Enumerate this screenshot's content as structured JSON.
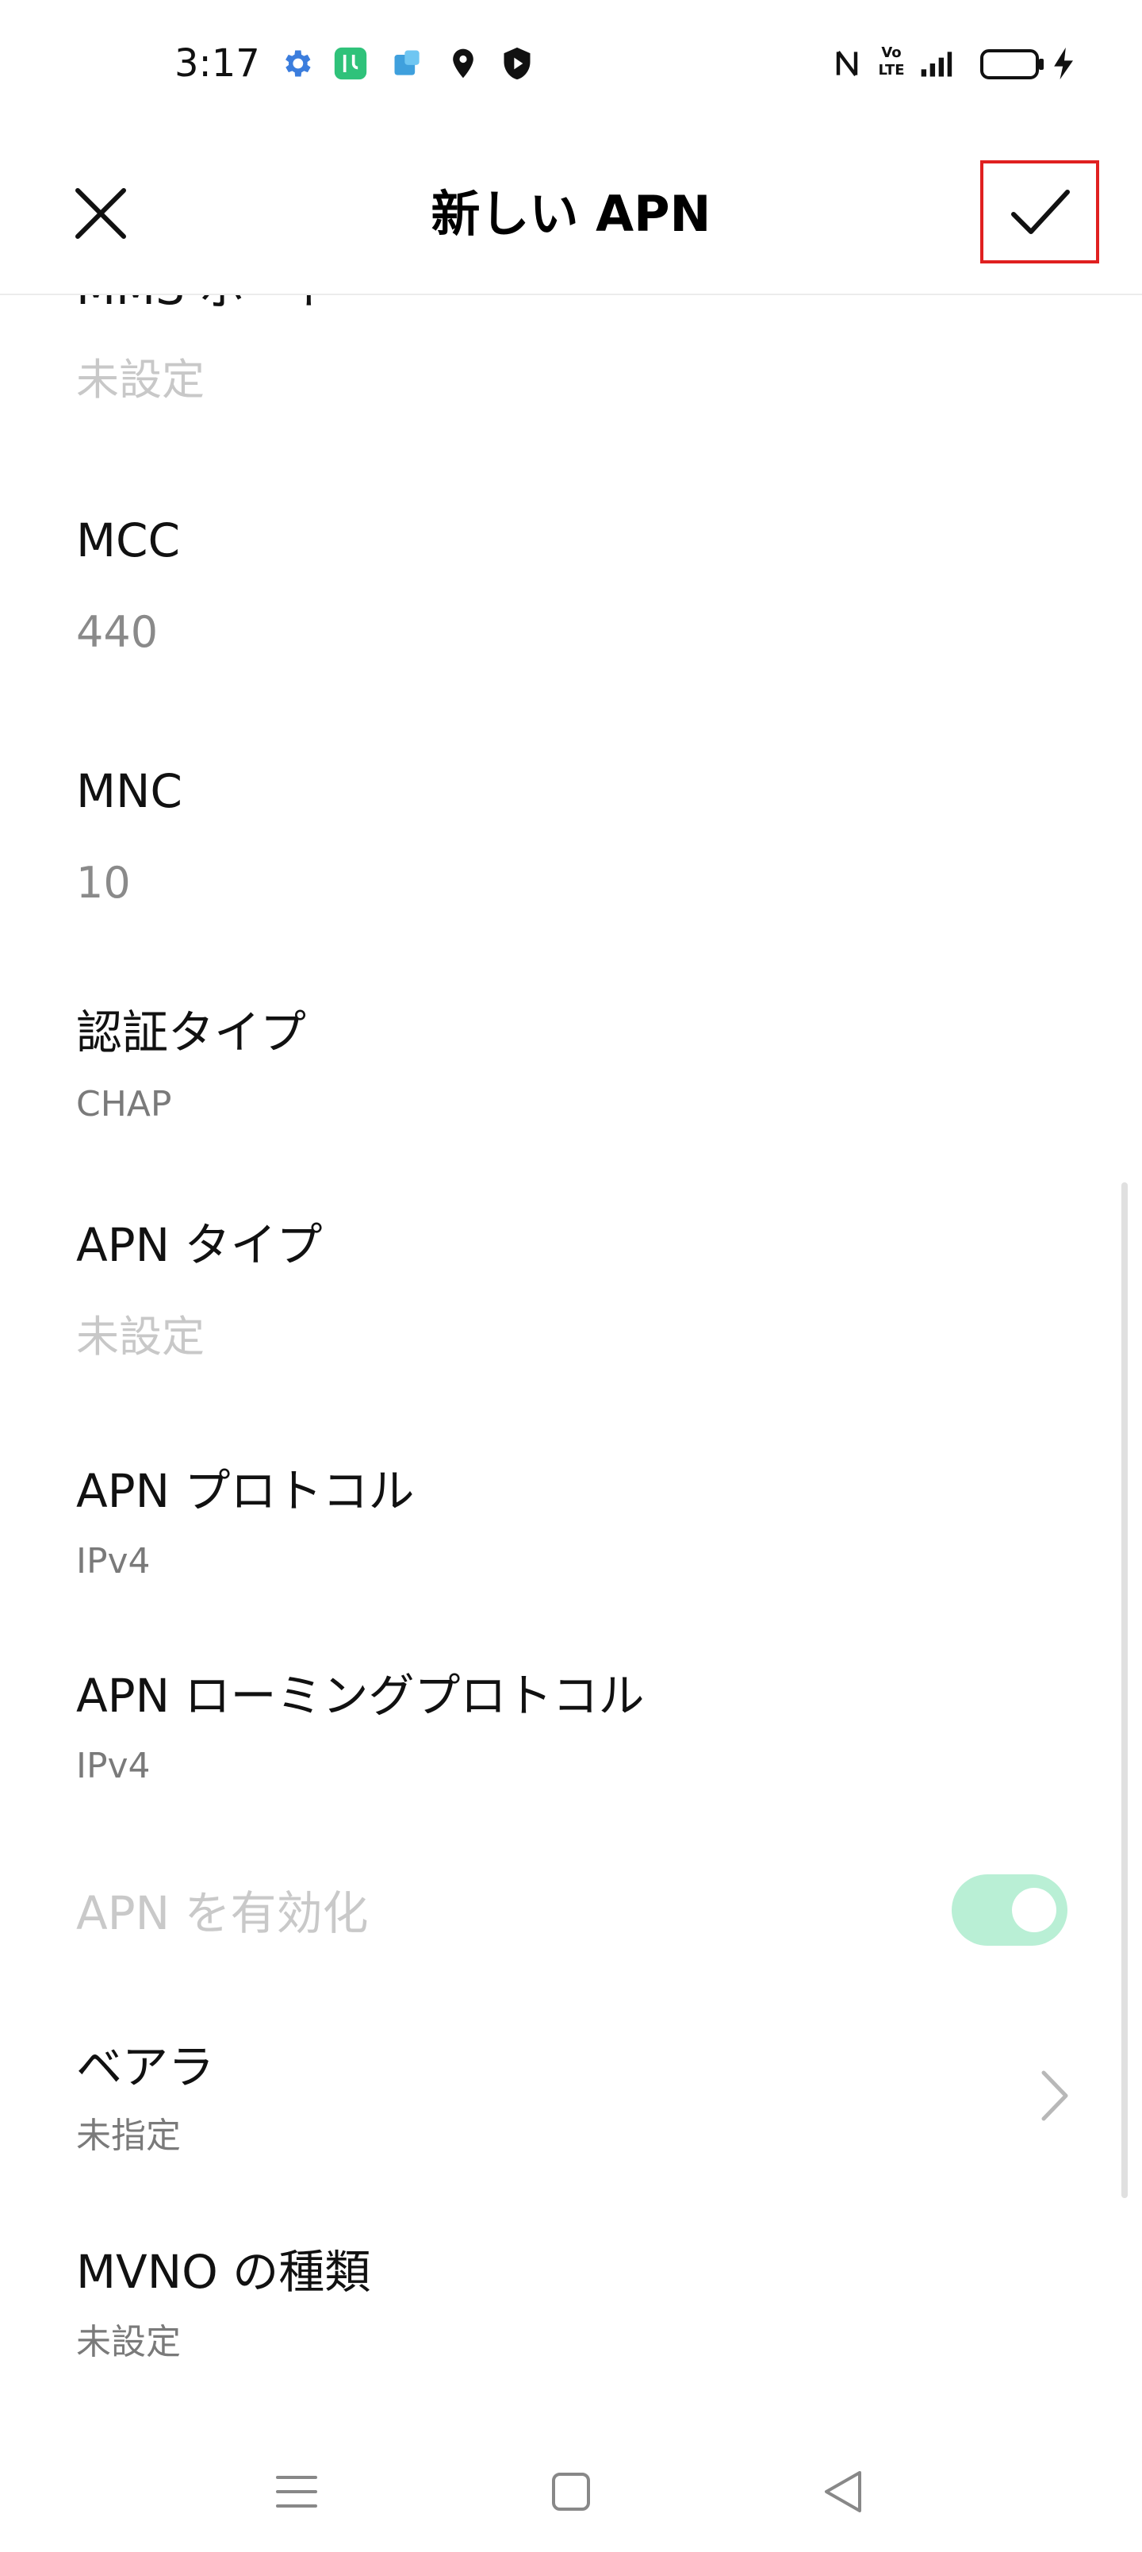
{
  "status_bar": {
    "time": "3:17",
    "left_icons": [
      "gear-icon",
      "green-app-icon",
      "blue-app-icon",
      "location-icon",
      "shield-play-icon"
    ],
    "right_icons": [
      "nfc-icon",
      "volte-icon",
      "signal-icon",
      "battery-icon",
      "charging-icon"
    ],
    "volte_text": "Vo LTE"
  },
  "app_bar": {
    "title": "新しい APN",
    "close_icon": "close-icon",
    "confirm_icon": "check-icon"
  },
  "fields": {
    "mms_port": {
      "label": "MMS ポート",
      "value": "未設定"
    },
    "mcc": {
      "label": "MCC",
      "value": "440"
    },
    "mnc": {
      "label": "MNC",
      "value": "10"
    },
    "auth_type": {
      "label": "認証タイプ",
      "value": "CHAP"
    },
    "apn_type": {
      "label": "APN タイプ",
      "value": "未設定"
    },
    "apn_protocol": {
      "label": "APN プロトコル",
      "value": "IPv4"
    },
    "apn_roaming_protocol": {
      "label": "APN ローミングプロトコル",
      "value": "IPv4"
    },
    "apn_enable": {
      "label": "APN を有効化",
      "enabled": true
    },
    "bearer": {
      "label": "ベアラ",
      "value": "未指定"
    },
    "mvno_type": {
      "label": "MVNO の種類",
      "value": "未設定"
    }
  },
  "colors": {
    "accent_toggle": "#b9efd5",
    "highlight_border": "#e02020"
  },
  "nav_bar": {
    "icons": [
      "menu-icon",
      "home-square-icon",
      "back-triangle-icon"
    ]
  }
}
